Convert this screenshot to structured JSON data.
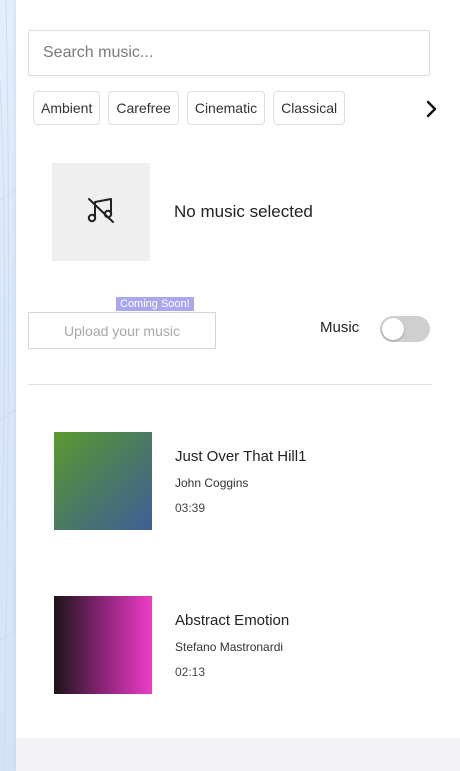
{
  "search": {
    "placeholder": "Search music..."
  },
  "genres": {
    "chips": [
      "Ambient",
      "Carefree",
      "Cinematic",
      "Classical"
    ],
    "next_icon": "chevron-right-icon"
  },
  "selected": {
    "icon": "music-off-icon",
    "text": "No music selected"
  },
  "upload": {
    "label": "Upload your music",
    "badge": "Coming Soon!"
  },
  "music_toggle": {
    "label": "Music",
    "on": false
  },
  "tracks": [
    {
      "title": "Just Over That Hill1",
      "artist": "John Coggins",
      "duration": "03:39",
      "colors": [
        "#5a9b2e",
        "#3f5f97"
      ]
    },
    {
      "title": "Abstract Emotion",
      "artist": "Stefano Mastronardi",
      "duration": "02:13",
      "colors": [
        "#1c1418",
        "#ee3cc6"
      ]
    }
  ],
  "colors": {
    "badge": "#a9a7ee",
    "toggle_off": "#cfcfcf"
  }
}
